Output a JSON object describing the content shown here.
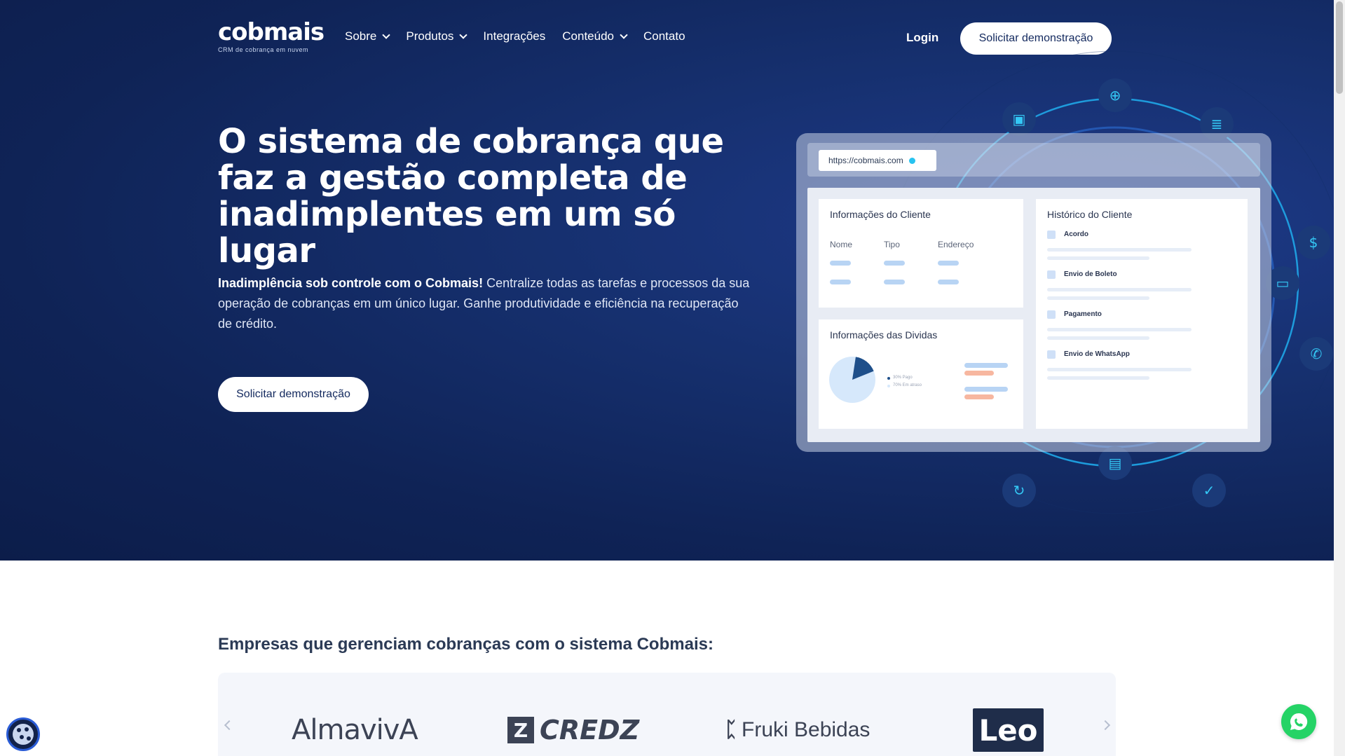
{
  "header": {
    "logo_text": "cobmais",
    "logo_tagline": "CRM de cobrança em nuvem",
    "nav": [
      {
        "label": "Sobre",
        "has_dropdown": true
      },
      {
        "label": "Produtos",
        "has_dropdown": true
      },
      {
        "label": "Integrações",
        "has_dropdown": false
      },
      {
        "label": "Conteúdo",
        "has_dropdown": true
      },
      {
        "label": "Contato",
        "has_dropdown": false
      }
    ],
    "login_label": "Login",
    "cta_label": "Solicitar demonstração"
  },
  "hero": {
    "title": "O sistema de cobrança que faz a gestão completa de inadimplentes em um só lugar",
    "desc_bold": "Inadimplência sob controle com o Cobmais!",
    "desc_rest": " Centralize todas as tarefas e processos da sua operação de cobranças em um único lugar. Ganhe produtividade e eficiência na recuperação de crédito.",
    "cta_label": "Solicitar demonstração"
  },
  "mockup": {
    "url": "https://cobmais.com",
    "client_info": {
      "title": "Informações do Cliente",
      "columns": [
        "Nome",
        "Tipo",
        "Endereço"
      ]
    },
    "debt_info": {
      "title": "Informações das Dividas",
      "legend": [
        "30% Pago",
        "70% Em atraso"
      ],
      "pie_paid_fraction": 0.3
    },
    "history": {
      "title": "Histórico do Cliente",
      "items": [
        "Acordo",
        "Envio de Boleto",
        "Pagamento",
        "Envio de WhatsApp"
      ]
    }
  },
  "clients": {
    "title": "Empresas que gerenciam cobranças com o sistema Cobmais:",
    "logos": [
      "AlmavivA",
      "CREDZ",
      "Fruki Bebidas",
      "Leo"
    ]
  },
  "colors": {
    "hero_bg": "#0f2356",
    "accent_cyan": "#27c3f0",
    "whatsapp_green": "#25d366"
  }
}
